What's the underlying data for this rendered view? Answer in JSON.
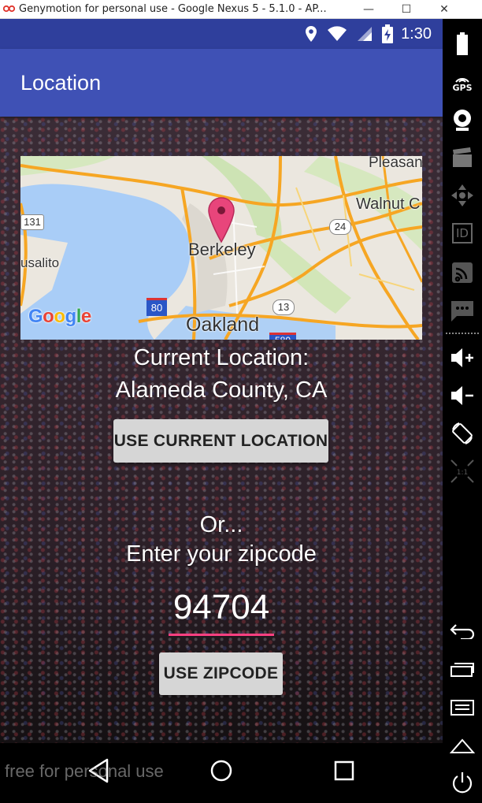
{
  "window": {
    "title": "Genymotion for personal use - Google Nexus 5 - 5.1.0 - AP...",
    "minimize": "—",
    "maximize": "☐",
    "close": "✕"
  },
  "statusbar": {
    "time": "1:30",
    "icons": [
      "location-icon",
      "wifi-icon",
      "signal-icon",
      "battery-charging-icon"
    ]
  },
  "appbar": {
    "title": "Location"
  },
  "map": {
    "labels": {
      "pleasant": "Pleasan",
      "walnut": "Walnut C",
      "berkeley": "Berkeley",
      "sausalito": "usalito",
      "oakland": "Oakland",
      "route_131": "131",
      "route_24": "24",
      "route_13": "13",
      "route_80": "80",
      "route_580": "580"
    },
    "logo": {
      "g1": "G",
      "o1": "o",
      "o2": "o",
      "g2": "g",
      "l": "l",
      "e": "e"
    }
  },
  "current_location": {
    "caption": "Current Location:",
    "value": "Alameda County, CA",
    "button_label": "USE CURRENT LOCATION"
  },
  "zipcode": {
    "or_text": "Or...",
    "prompt": "Enter your zipcode",
    "value": "94704",
    "button_label": "USE ZIPCODE"
  },
  "watermark": "free for personal use",
  "colors": {
    "status_bar": "#2f3f9c",
    "app_bar": "#3f51b5",
    "accent": "#ff4081",
    "button": "#d6d6d6"
  },
  "side_panel": {
    "icons": [
      "battery-icon",
      "gps-icon",
      "camera-icon",
      "video-icon",
      "dpad-icon",
      "id-icon",
      "cast-icon",
      "sms-icon",
      "volume-up-icon",
      "volume-down-icon",
      "rotate-icon",
      "scale-icon",
      "back-icon",
      "recent-apps-icon",
      "menu-icon",
      "home-icon",
      "power-icon"
    ],
    "gps_label": "GPS",
    "id_label": "ID",
    "scale_label": "1:1"
  }
}
